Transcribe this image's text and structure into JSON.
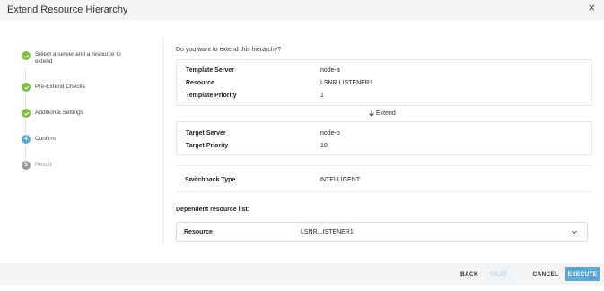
{
  "dialog": {
    "title": "Extend Resource Hierarchy",
    "close_label": "×"
  },
  "steps": [
    {
      "label": "Select a server and a resource to extend",
      "state": "done",
      "number": "1"
    },
    {
      "label": "Pre-Extend Checks",
      "state": "done",
      "number": "2"
    },
    {
      "label": "Additional Settings",
      "state": "done",
      "number": "3"
    },
    {
      "label": "Confirm",
      "state": "current",
      "number": "4"
    },
    {
      "label": "Result",
      "state": "pending",
      "number": "5"
    }
  ],
  "main": {
    "question": "Do you want to extend this hierarchy?",
    "template": {
      "server_label": "Template Server",
      "server_value": "node-a",
      "resource_label": "Resource",
      "resource_value": "LSNR.LISTENER1",
      "priority_label": "Template Priority",
      "priority_value": "1"
    },
    "extend_label": "Extend",
    "target": {
      "server_label": "Target Server",
      "server_value": "node-b",
      "priority_label": "Target Priority",
      "priority_value": "10"
    },
    "switchback": {
      "label": "Switchback Type",
      "value": "INTELLIGENT"
    },
    "dependent": {
      "heading": "Dependent resource list:",
      "resource_label": "Resource",
      "resource_value": "LSNR.LISTENER1"
    }
  },
  "footer": {
    "back": "BACK",
    "next": "NEXT",
    "cancel": "CANCEL",
    "execute": "EXECUTE"
  },
  "colors": {
    "accent": "#5aa7d8",
    "done": "#7ac142",
    "pending": "#9a9a9a"
  }
}
